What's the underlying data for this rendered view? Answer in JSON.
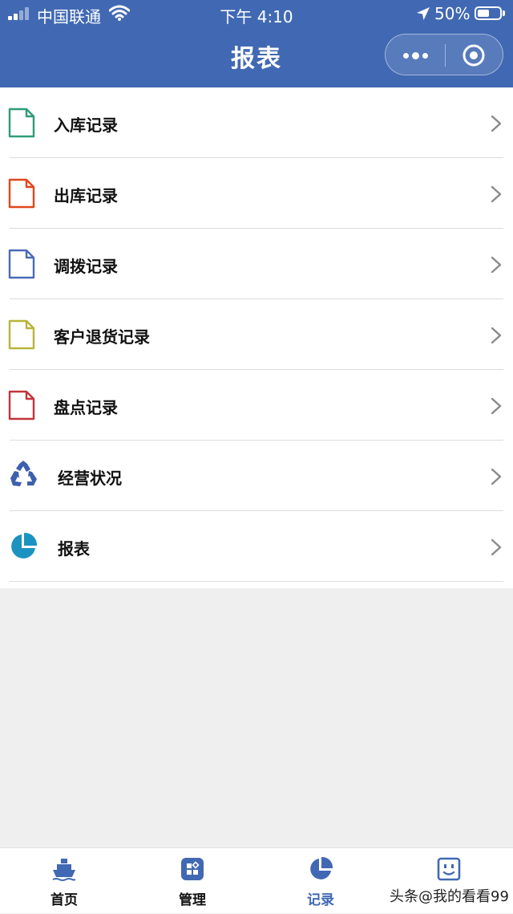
{
  "status_bar": {
    "carrier": "中国联通",
    "time": "下午 4:10",
    "battery": "50%",
    "battery_level": 0.5
  },
  "nav": {
    "title": "报表"
  },
  "list": [
    {
      "label": "入库记录",
      "icon": "document-icon",
      "color": "#2e9c76"
    },
    {
      "label": "出库记录",
      "icon": "document-icon",
      "color": "#e0471c"
    },
    {
      "label": "调拨记录",
      "icon": "document-icon",
      "color": "#4a6bb5"
    },
    {
      "label": "客户退货记录",
      "icon": "document-icon",
      "color": "#b8b43a"
    },
    {
      "label": "盘点记录",
      "icon": "document-icon",
      "color": "#c2343b"
    },
    {
      "label": "经营状况",
      "icon": "recycle-icon",
      "color": "#3d5fae"
    },
    {
      "label": "报表",
      "icon": "pie-chart-icon",
      "color": "#1b93c0"
    }
  ],
  "tabs": [
    {
      "label": "首页",
      "icon": "ship-icon"
    },
    {
      "label": "管理",
      "icon": "grid-icon"
    },
    {
      "label": "记录",
      "icon": "pie-chart-icon",
      "active": true
    },
    {
      "label": "",
      "icon": "face-icon"
    }
  ],
  "watermark": "头条@我的看看99",
  "colors": {
    "brand": "#4169b3",
    "background": "#efefef"
  }
}
